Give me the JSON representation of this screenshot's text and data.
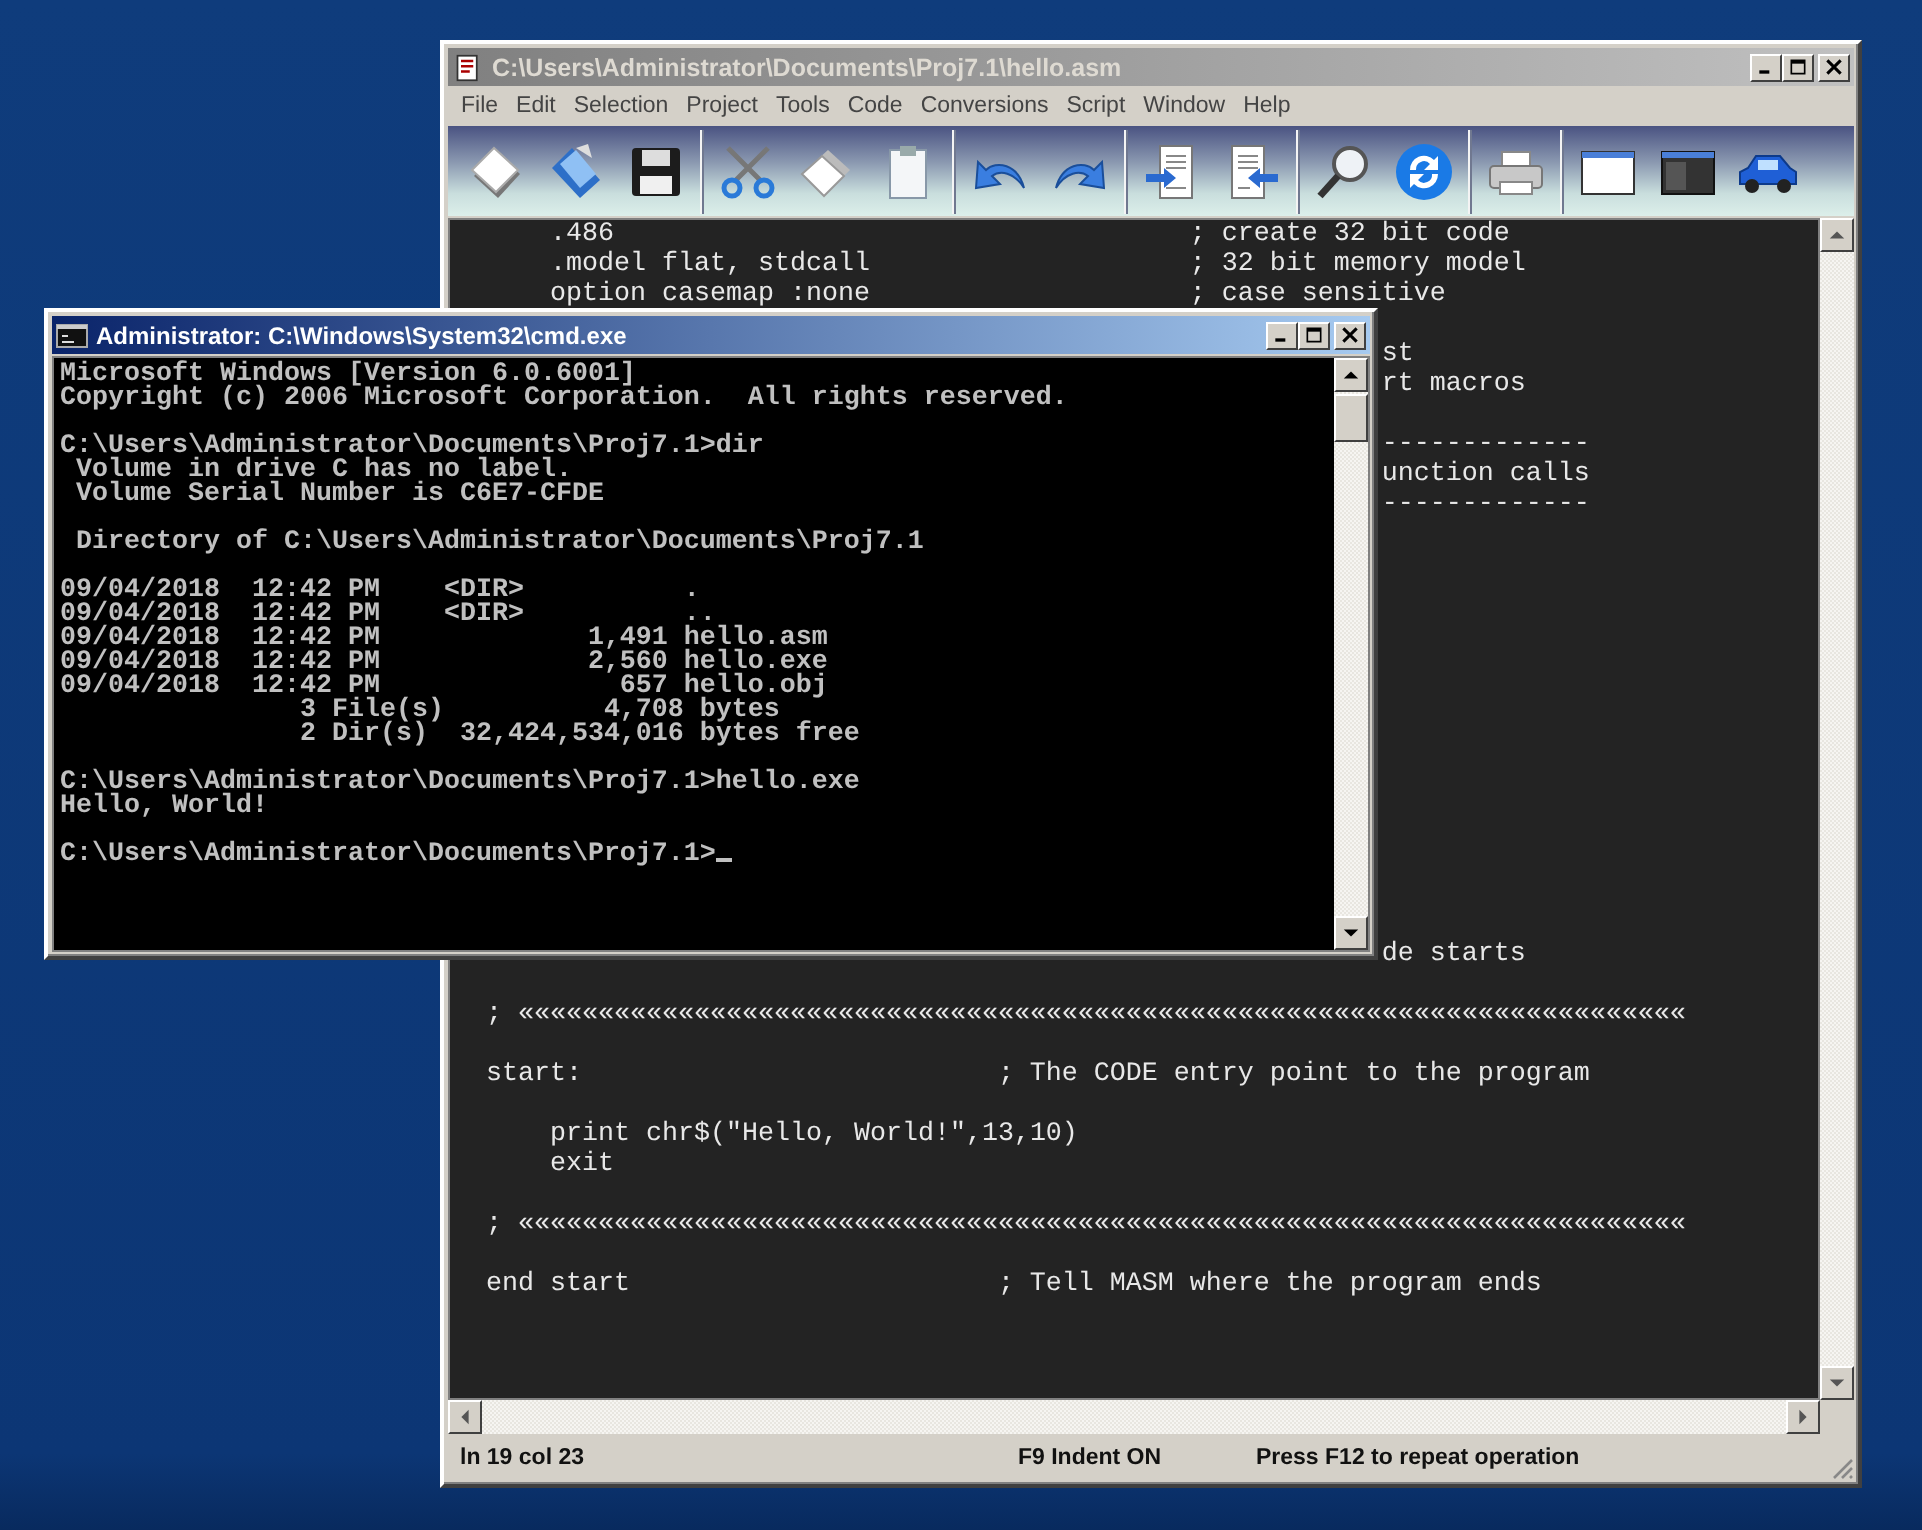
{
  "editor": {
    "title": "C:\\Users\\Administrator\\Documents\\Proj7.1\\hello.asm",
    "active": false,
    "menu": [
      "File",
      "Edit",
      "Selection",
      "Project",
      "Tools",
      "Code",
      "Conversions",
      "Script",
      "Window",
      "Help"
    ],
    "top_blocks": [
      [
        {
          "kind": "code",
          "code": "    .486",
          "comment": "; create 32 bit code"
        },
        {
          "kind": "code",
          "code": "    .model flat, stdcall",
          "comment": "; 32 bit memory model"
        },
        {
          "kind": "code",
          "code": "    option casemap :none",
          "comment": "; case sensitive"
        }
      ],
      [
        {
          "kind": "tail",
          "text": "st"
        },
        {
          "kind": "tail",
          "text": "rt macros"
        }
      ],
      [
        {
          "kind": "tail",
          "text": "-------------"
        },
        {
          "kind": "tail",
          "text": "unction calls"
        },
        {
          "kind": "tail",
          "text": "-------------"
        }
      ]
    ],
    "bottom_blocks": [
      [
        {
          "kind": "tail",
          "text": "de starts"
        }
      ],
      [
        {
          "kind": "code",
          "code": "; «««««««««««««««««««««««««««««««««««««««««««««««««««««««««««««««««««««««««"
        }
      ],
      [
        {
          "kind": "code",
          "code": "start:",
          "comment": "; The CODE entry point to the program"
        }
      ],
      [
        {
          "kind": "code",
          "code": "    print chr$(\"Hello, World!\",13,10)"
        },
        {
          "kind": "code",
          "code": "    exit"
        }
      ],
      [
        {
          "kind": "code",
          "code": "; «««««««««««««««««««««««««««««««««««««««««««««««««««««««««««««««««««««««««"
        }
      ],
      [
        {
          "kind": "code",
          "code": "end start",
          "comment": "; Tell MASM where the program ends"
        }
      ]
    ],
    "status": [
      "ln 19 col 23",
      "F9 Indent ON",
      "Press F12 to repeat operation"
    ]
  },
  "console": {
    "title": "Administrator: C:\\Windows\\System32\\cmd.exe",
    "active": true,
    "cursor": true,
    "blocks": [
      [
        "Microsoft Windows [Version 6.0.6001]",
        "Copyright (c) 2006 Microsoft Corporation.  All rights reserved."
      ],
      [
        "C:\\Users\\Administrator\\Documents\\Proj7.1>dir",
        " Volume in drive C has no label.",
        " Volume Serial Number is C6E7-CFDE"
      ],
      [
        " Directory of C:\\Users\\Administrator\\Documents\\Proj7.1"
      ],
      [
        "09/04/2018  12:42 PM    <DIR>          .",
        "09/04/2018  12:42 PM    <DIR>          ..",
        "09/04/2018  12:42 PM             1,491 hello.asm",
        "09/04/2018  12:42 PM             2,560 hello.exe",
        "09/04/2018  12:42 PM               657 hello.obj",
        "               3 File(s)          4,708 bytes",
        "               2 Dir(s)  32,424,534,016 bytes free"
      ],
      [
        "C:\\Users\\Administrator\\Documents\\Proj7.1>hello.exe",
        "Hello, World!"
      ],
      [
        "C:\\Users\\Administrator\\Documents\\Proj7.1>"
      ]
    ]
  }
}
